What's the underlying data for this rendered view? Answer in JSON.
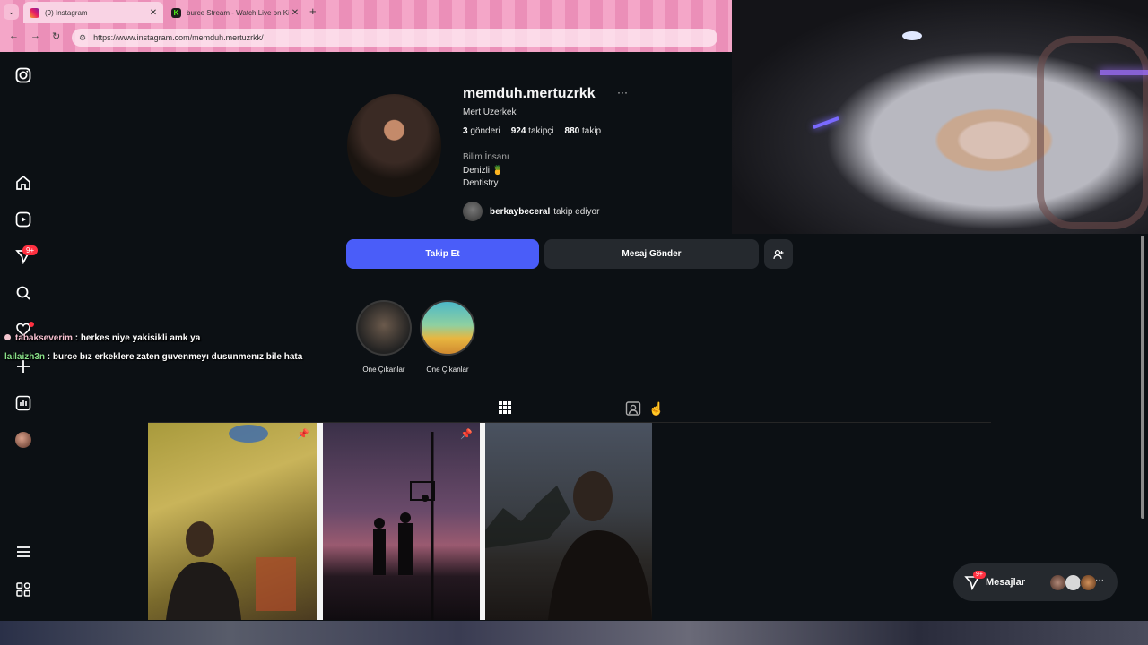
{
  "browser": {
    "tabs": [
      {
        "title": "(9) Instagram",
        "active": true
      },
      {
        "title": "burce Stream - Watch Live on Ki",
        "active": false
      }
    ],
    "url": "https://www.instagram.com/memduh.mertuzrkk/"
  },
  "sidebar": {
    "notifications_badge": "9+"
  },
  "profile": {
    "username": "memduh.mertuzrkk",
    "full_name": "Mert Uzerkek",
    "posts_count": "3",
    "posts_label": "gönderi",
    "followers_count": "924",
    "followers_label": "takipçi",
    "following_count": "880",
    "following_label": "takip",
    "category": "Bilim İnsanı",
    "bio_lines": [
      "Denizli 🍍",
      "Dentistry"
    ],
    "followed_by_user": "berkaybeceral",
    "followed_by_text": "takip ediyor"
  },
  "actions": {
    "follow": "Takip Et",
    "message": "Mesaj Gönder"
  },
  "highlights": [
    {
      "label": "Öne Çıkanlar"
    },
    {
      "label": "Öne Çıkanlar"
    }
  ],
  "messages_pill": {
    "label": "Mesajlar",
    "badge": "9+"
  },
  "chat": [
    {
      "user": "tabakseverim",
      "text": " : herkes niye yakisikli amk ya"
    },
    {
      "user": "lailaizh3n",
      "text": " : burce bız erkeklere zaten guvenmeyı dusunmenız bile hata"
    }
  ],
  "colors": {
    "accent_button": "#4a5df9",
    "background": "#0c1014",
    "badge": "#ff3040"
  }
}
